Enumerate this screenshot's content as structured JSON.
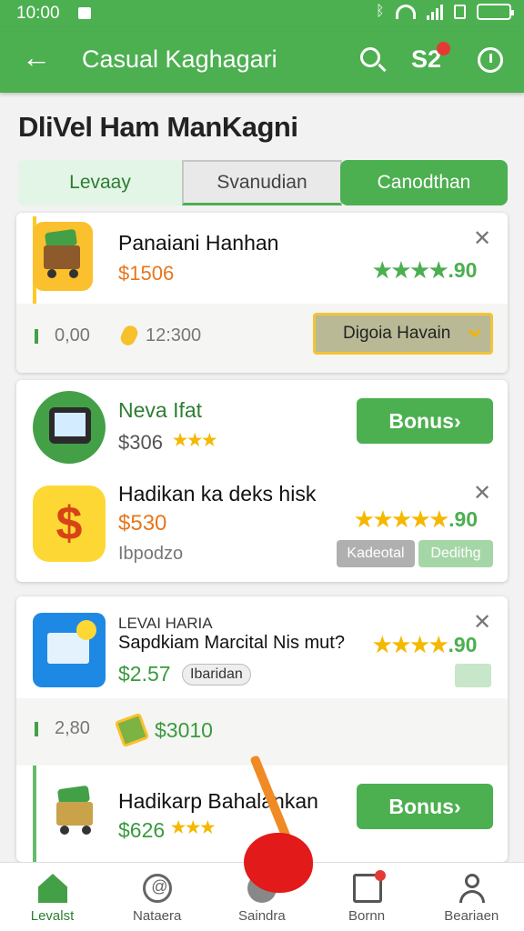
{
  "status_bar": {
    "time": "10:00"
  },
  "app_bar": {
    "title": "Casual Kaghagari",
    "coins": "S2"
  },
  "page_title": "DliVel Ham ManKagni",
  "tabs": [
    "Levaay",
    "Svanudian",
    "Canodthan"
  ],
  "card1": {
    "title": "Panaiani Hanhan",
    "price": "$1506",
    "rating": "★★★★.90",
    "meta_time": "0,00",
    "meta_coins": "12:300",
    "dropdown": "Digoia Havain"
  },
  "card2": {
    "item1": {
      "title": "Neva Ifat",
      "price": "$306",
      "stars": "★★★",
      "button": "Bonus›"
    },
    "item2": {
      "title": "Hadikan ka deks hisk",
      "price": "$530",
      "rating_stars": "★★★★★",
      "rating_num": ".90",
      "sub": "Ibpodzo",
      "pill1": "Kadeotal",
      "pill2": "Dedithg"
    }
  },
  "card3": {
    "caps": "LEVAI HARIA",
    "title": "Sapdkiam Marcital Nis mut?",
    "rating_stars": "★★★★",
    "rating_num": ".90",
    "price": "$2.57",
    "tag": "Ibaridan",
    "meta_time": "2,80",
    "meta_value": "$3010",
    "item2": {
      "title": "Hadikarp Bahalankan",
      "price": "$626",
      "stars": "★★★",
      "button": "Bonus›"
    }
  },
  "bottom_nav": [
    {
      "label": "Levalst",
      "icon": "home-icon"
    },
    {
      "label": "Nataera",
      "icon": "at-icon"
    },
    {
      "label": "Saindra",
      "icon": "gear-icon"
    },
    {
      "label": "Bornn",
      "icon": "clipboard-icon"
    },
    {
      "label": "Beariaen",
      "icon": "person-icon"
    }
  ],
  "colors": {
    "primary": "#4caf50",
    "accent_orange": "#e8761c",
    "star_gold": "#f5b800"
  }
}
